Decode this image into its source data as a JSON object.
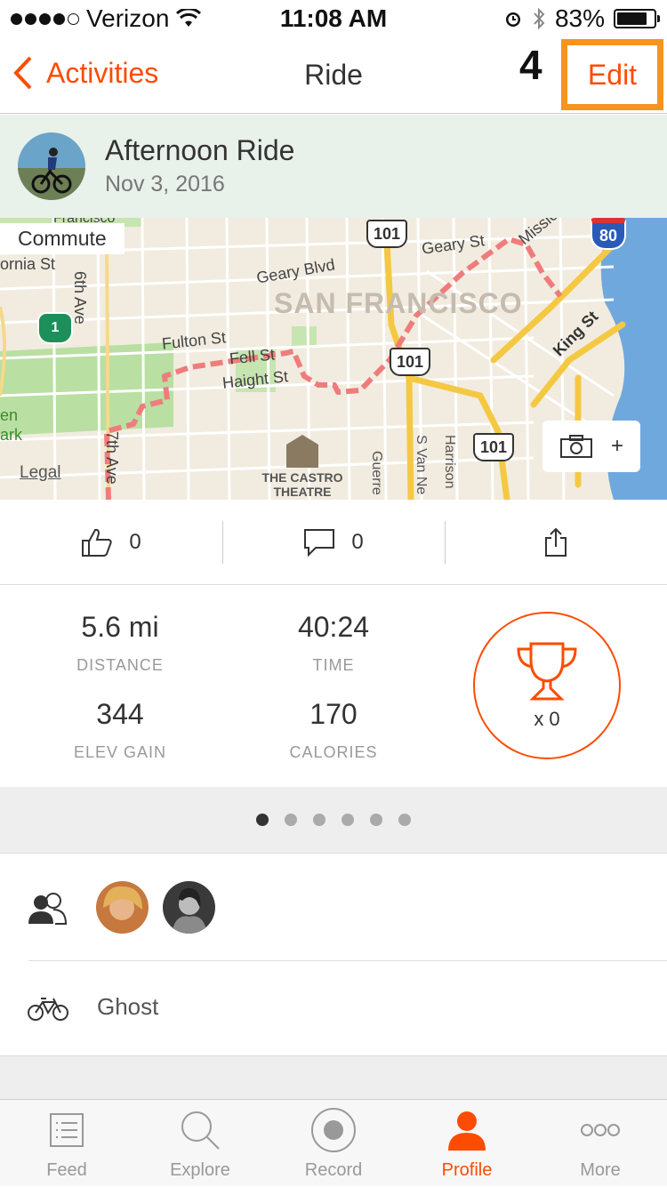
{
  "status": {
    "carrier": "Verizon",
    "time": "11:08 AM",
    "battery": "83%",
    "battery_level": 0.83
  },
  "nav": {
    "back_label": "Activities",
    "title": "Ride",
    "step_marker": "4",
    "edit_label": "Edit"
  },
  "activity": {
    "name": "Afternoon Ride",
    "date": "Nov 3, 2016"
  },
  "map": {
    "tag": "Commute",
    "legal": "Legal",
    "labels": {
      "city": "SAN FRANCISCO",
      "geary_blvd": "Geary Blvd",
      "geary_st": "Geary St",
      "fulton": "Fulton St",
      "fell": "Fell St",
      "haight": "Haight St",
      "king": "King St",
      "mission": "Missio",
      "cornia": "ornia St",
      "sixth_ave": "6th Ave",
      "seventh_ave": "7th Ave",
      "castro1": "THE CASTRO",
      "castro2": "THEATRE",
      "guerrero": "Guerre",
      "svan": "S Van Ne",
      "harrison": "Harrison",
      "park1": "en",
      "park2": "ark",
      "francisco": "Francisco"
    },
    "shields": {
      "hw101": "101",
      "i80": "80",
      "ca1": "1"
    },
    "photo_add": "+"
  },
  "actions": {
    "kudos_count": "0",
    "comments_count": "0"
  },
  "stats": [
    {
      "value": "5.6 mi",
      "label": "DISTANCE"
    },
    {
      "value": "40:24",
      "label": "TIME"
    },
    {
      "value": "344",
      "label": "ELEV GAIN"
    },
    {
      "value": "170",
      "label": "CALORIES"
    }
  ],
  "achievements": {
    "count": "x 0"
  },
  "pager": {
    "pages": 6,
    "current": 1
  },
  "gear": {
    "name": "Ghost"
  },
  "tabs": [
    {
      "label": "Feed"
    },
    {
      "label": "Explore"
    },
    {
      "label": "Record"
    },
    {
      "label": "Profile"
    },
    {
      "label": "More"
    }
  ],
  "colors": {
    "accent": "#fc4c02",
    "highlight": "#f7941d",
    "route": "#ef7c7c",
    "highway": "#f5c842",
    "water": "#6fa8dc",
    "park": "#b9dfa3"
  }
}
